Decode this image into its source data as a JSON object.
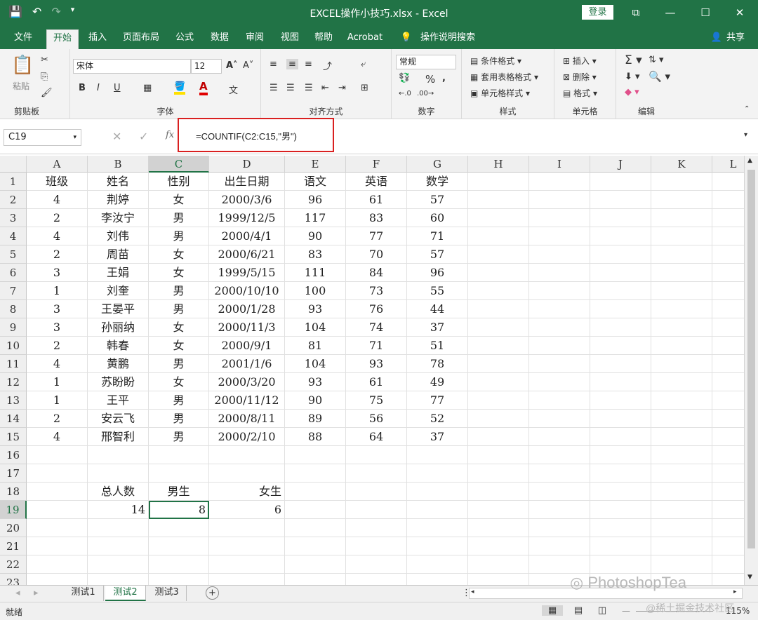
{
  "window": {
    "title": "EXCEL操作小技巧.xlsx  -  Excel",
    "login_label": "登录",
    "controls": {
      "restore": "⧉",
      "minimize": "—",
      "maximize": "☐",
      "close": "✕"
    }
  },
  "tabs": [
    {
      "label": "文件",
      "active": false
    },
    {
      "label": "开始",
      "active": true
    },
    {
      "label": "插入",
      "active": false
    },
    {
      "label": "页面布局",
      "active": false
    },
    {
      "label": "公式",
      "active": false
    },
    {
      "label": "数据",
      "active": false
    },
    {
      "label": "审阅",
      "active": false
    },
    {
      "label": "视图",
      "active": false
    },
    {
      "label": "帮助",
      "active": false
    },
    {
      "label": "Acrobat",
      "active": false
    }
  ],
  "tell_me": "操作说明搜索",
  "share_label": "共享",
  "ribbon": {
    "clipboard": {
      "paste_label": "粘贴",
      "group_label": "剪贴板"
    },
    "font": {
      "font_name": "宋体",
      "font_size": "12",
      "group_label": "字体",
      "bold": "B",
      "italic": "I",
      "underline": "U"
    },
    "alignment": {
      "group_label": "对齐方式"
    },
    "number": {
      "format": "常规",
      "group_label": "数字",
      "percent": "%"
    },
    "styles": {
      "conditional": "条件格式",
      "table_format": "套用表格格式",
      "cell_styles": "单元格样式",
      "group_label": "样式"
    },
    "cells": {
      "insert": "插入",
      "delete": "删除",
      "format": "格式",
      "group_label": "单元格"
    },
    "editing": {
      "group_label": "编辑"
    }
  },
  "formula_bar": {
    "name_box": "C19",
    "fx": "fx",
    "formula": "=COUNTIF(C2:C15,\"男\")"
  },
  "columns": [
    "A",
    "B",
    "C",
    "D",
    "E",
    "F",
    "G",
    "H",
    "I",
    "J",
    "K",
    "L"
  ],
  "selected_column": "C",
  "selected_row": 19,
  "rows": [
    {
      "n": "1",
      "cells": [
        "班级",
        "姓名",
        "性别",
        "出生日期",
        "语文",
        "英语",
        "数学"
      ]
    },
    {
      "n": "2",
      "cells": [
        "4",
        "荆婷",
        "女",
        "2000/3/6",
        "96",
        "61",
        "57"
      ]
    },
    {
      "n": "3",
      "cells": [
        "2",
        "李汝宁",
        "男",
        "1999/12/5",
        "117",
        "83",
        "60"
      ]
    },
    {
      "n": "4",
      "cells": [
        "4",
        "刘伟",
        "男",
        "2000/4/1",
        "90",
        "77",
        "71"
      ]
    },
    {
      "n": "5",
      "cells": [
        "2",
        "周苗",
        "女",
        "2000/6/21",
        "83",
        "70",
        "57"
      ]
    },
    {
      "n": "6",
      "cells": [
        "3",
        "王娟",
        "女",
        "1999/5/15",
        "111",
        "84",
        "96"
      ]
    },
    {
      "n": "7",
      "cells": [
        "1",
        "刘奎",
        "男",
        "2000/10/10",
        "100",
        "73",
        "55"
      ]
    },
    {
      "n": "8",
      "cells": [
        "3",
        "王晏平",
        "男",
        "2000/1/28",
        "93",
        "76",
        "44"
      ]
    },
    {
      "n": "9",
      "cells": [
        "3",
        "孙丽纳",
        "女",
        "2000/11/3",
        "104",
        "74",
        "37"
      ]
    },
    {
      "n": "10",
      "cells": [
        "2",
        "韩春",
        "女",
        "2000/9/1",
        "81",
        "71",
        "51"
      ]
    },
    {
      "n": "11",
      "cells": [
        "4",
        "黄鹏",
        "男",
        "2001/1/6",
        "104",
        "93",
        "78"
      ]
    },
    {
      "n": "12",
      "cells": [
        "1",
        "苏盼盼",
        "女",
        "2000/3/20",
        "93",
        "61",
        "49"
      ]
    },
    {
      "n": "13",
      "cells": [
        "1",
        "王平",
        "男",
        "2000/11/12",
        "90",
        "75",
        "77"
      ]
    },
    {
      "n": "14",
      "cells": [
        "2",
        "安云飞",
        "男",
        "2000/8/11",
        "89",
        "56",
        "52"
      ]
    },
    {
      "n": "15",
      "cells": [
        "4",
        "邢智利",
        "男",
        "2000/2/10",
        "88",
        "64",
        "37"
      ]
    },
    {
      "n": "16",
      "cells": []
    },
    {
      "n": "17",
      "cells": []
    },
    {
      "n": "18",
      "cells": [
        "",
        "总人数",
        "男生",
        "女生"
      ]
    },
    {
      "n": "19",
      "cells": [
        "",
        "14",
        "8",
        "6"
      ]
    },
    {
      "n": "20",
      "cells": []
    },
    {
      "n": "21",
      "cells": []
    },
    {
      "n": "22",
      "cells": []
    },
    {
      "n": "23",
      "cells": []
    }
  ],
  "sheets": [
    {
      "label": "测试1",
      "active": false
    },
    {
      "label": "测试2",
      "active": true
    },
    {
      "label": "测试3",
      "active": false
    }
  ],
  "status": {
    "ready": "就绪",
    "zoom": "115%"
  },
  "watermark": {
    "brand": "PhotoshopTea",
    "community": "@稀土掘金技术社区"
  }
}
